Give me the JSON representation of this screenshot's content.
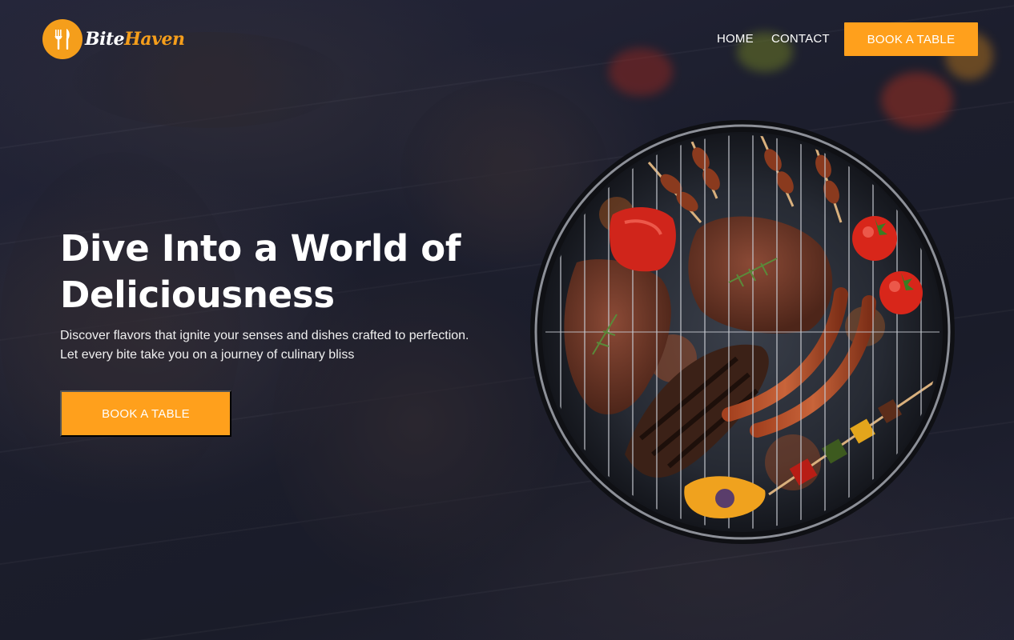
{
  "brand": {
    "name_part1": "Bite",
    "name_part2": "Haven",
    "accent_color": "#ffa01c",
    "icon": "fork-knife-icon"
  },
  "nav": {
    "links": [
      {
        "label": "HOME"
      },
      {
        "label": "CONTACT"
      }
    ],
    "cta_label": "BOOK A TABLE"
  },
  "hero": {
    "title_line1": "Dive Into a World of",
    "title_line2": "Deliciousness",
    "subtitle_line1": "Discover flavors that ignite your senses and dishes crafted to perfection.",
    "subtitle_line2": "Let every bite take you on a journey of culinary bliss",
    "cta_label": "BOOK A TABLE"
  },
  "colors": {
    "background": "#1b1d2a",
    "button": "#ffa01c",
    "text": "#ffffff"
  }
}
